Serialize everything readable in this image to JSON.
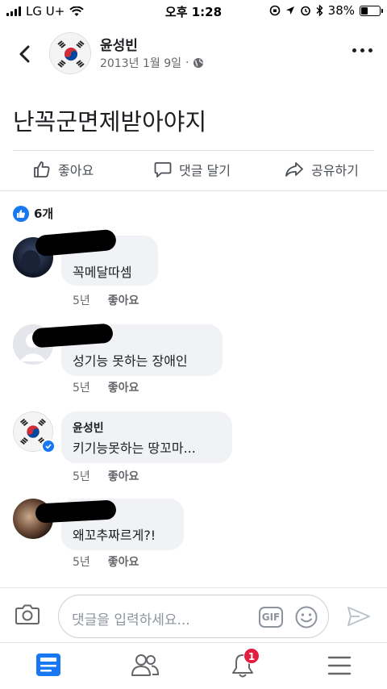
{
  "status_bar": {
    "carrier": "LG U+",
    "time": "오후 1:28",
    "battery": "38%",
    "battery_level": 0.38
  },
  "header": {
    "author": "윤성빈",
    "date": "2013년 1월 9일",
    "date_separator": "·",
    "icons": [
      "back-chevron-icon",
      "globe-icon",
      "more-dots-icon"
    ]
  },
  "post": {
    "text": "난꼭군면제받아야지"
  },
  "actions": {
    "like": "좋아요",
    "comment": "댓글 달기",
    "share": "공유하기"
  },
  "reactions": {
    "count": "6개"
  },
  "comments": [
    {
      "name": "",
      "text": "꼭메달따셈",
      "time": "5년",
      "like": "좋아요"
    },
    {
      "name": "",
      "text": "성기능 못하는 장애인",
      "time": "5년",
      "like": "좋아요"
    },
    {
      "name": "윤성빈",
      "text": "키기능못하는 땅꼬마...",
      "time": "5년",
      "like": "좋아요"
    },
    {
      "name": "",
      "text": "왜꼬추짜르게?!",
      "time": "5년",
      "like": "좋아요"
    }
  ],
  "composer": {
    "placeholder": "댓글을 입력하세요...",
    "gif": "GIF"
  },
  "tabbar": {
    "notification_count": "1",
    "icons": [
      "news-feed-icon",
      "friends-icon",
      "bell-icon",
      "menu-icon"
    ]
  },
  "colors": {
    "accent": "#1877f2",
    "bubble": "#f0f2f5",
    "badge": "#e41e3f"
  }
}
